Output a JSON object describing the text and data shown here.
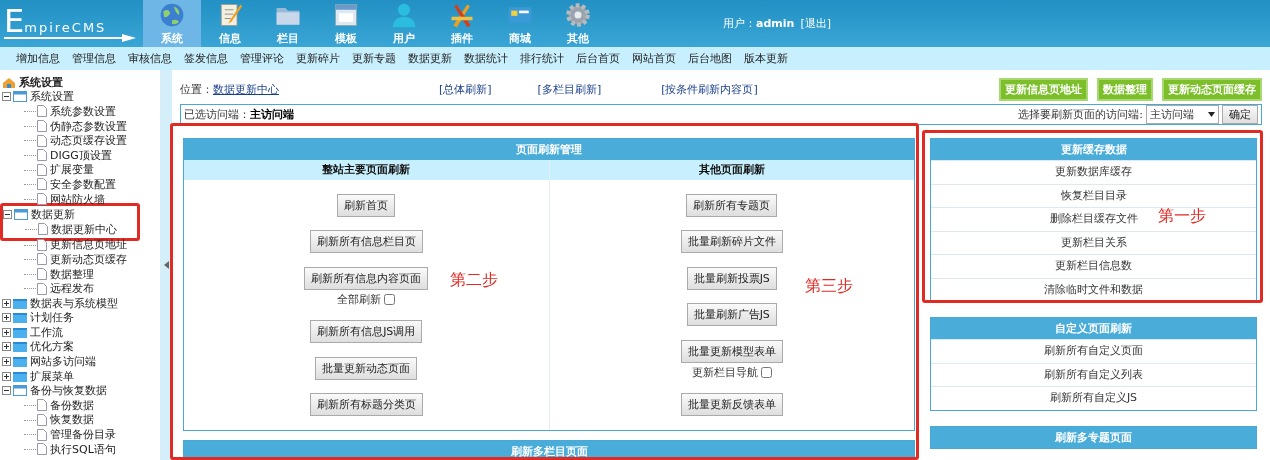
{
  "header": {
    "logo": "EmpireCMS",
    "nav": [
      {
        "label": "系统",
        "selected": true
      },
      {
        "label": "信息",
        "selected": false
      },
      {
        "label": "栏目",
        "selected": false
      },
      {
        "label": "模板",
        "selected": false
      },
      {
        "label": "用户",
        "selected": false
      },
      {
        "label": "插件",
        "selected": false
      },
      {
        "label": "商城",
        "selected": false
      },
      {
        "label": "其他",
        "selected": false
      }
    ],
    "user": {
      "label": "用户：",
      "name": "admin",
      "logout": "[退出]"
    }
  },
  "menu": [
    "增加信息",
    "管理信息",
    "审核信息",
    "签发信息",
    "管理评论",
    "更新碎片",
    "更新专题",
    "数据更新",
    "数据统计",
    "排行统计",
    "后台首页",
    "网站首页",
    "后台地图",
    "版本更新"
  ],
  "sidebar": {
    "title": "系统设置",
    "items": [
      {
        "label": "系统设置",
        "expanded": true,
        "children": [
          {
            "label": "系统参数设置"
          },
          {
            "label": "伪静态参数设置"
          },
          {
            "label": "动态页缓存设置"
          },
          {
            "label": "DIGG顶设置"
          },
          {
            "label": "扩展变量"
          },
          {
            "label": "安全参数配置"
          },
          {
            "label": "网站防火墙"
          }
        ]
      },
      {
        "label": "数据更新",
        "expanded": true,
        "children": [
          {
            "label": "数据更新中心"
          },
          {
            "label": "更新信息页地址"
          },
          {
            "label": "更新动态页缓存"
          },
          {
            "label": "数据整理"
          },
          {
            "label": "远程发布"
          }
        ]
      },
      {
        "label": "数据表与系统模型",
        "expanded": false
      },
      {
        "label": "计划任务",
        "expanded": false
      },
      {
        "label": "工作流",
        "expanded": false
      },
      {
        "label": "优化方案",
        "expanded": false
      },
      {
        "label": "网站多访问端",
        "expanded": false
      },
      {
        "label": "扩展菜单",
        "expanded": false
      },
      {
        "label": "备份与恢复数据",
        "expanded": true,
        "children": [
          {
            "label": "备份数据"
          },
          {
            "label": "恢复数据"
          },
          {
            "label": "管理备份目录"
          },
          {
            "label": "执行SQL语句"
          }
        ]
      }
    ]
  },
  "location": {
    "label": "位置：",
    "current": "数据更新中心",
    "links": [
      "[总体刷新]",
      "[多栏目刷新]",
      "[按条件刷新内容页]"
    ],
    "buttons": [
      "更新信息页地址",
      "数据整理",
      "更新动态页面缓存"
    ]
  },
  "access": {
    "label": "已选访问端：",
    "current": "主访问端",
    "select_label": "选择要刷新页面的访问端:",
    "select_value": "主访问端",
    "confirm": "确定"
  },
  "refresh_panel": {
    "title": "页面刷新管理",
    "columns": [
      {
        "title": "整站主要页面刷新",
        "items": [
          {
            "label": "刷新首页"
          },
          {
            "label": "刷新所有信息栏目页"
          },
          {
            "label": "刷新所有信息内容页面",
            "option": {
              "label": "全部刷新",
              "checked": false
            }
          },
          {
            "label": "刷新所有信息JS调用"
          },
          {
            "label": "批量更新动态页面"
          },
          {
            "label": "刷新所有标题分类页"
          }
        ]
      },
      {
        "title": "其他页面刷新",
        "items": [
          {
            "label": "刷新所有专题页"
          },
          {
            "label": "批量刷新碎片文件"
          },
          {
            "label": "批量刷新投票JS"
          },
          {
            "label": "批量刷新广告JS"
          },
          {
            "label": "批量更新模型表单",
            "option": {
              "label": "更新栏目导航",
              "checked": false
            }
          },
          {
            "label": "批量更新反馈表单"
          }
        ]
      }
    ]
  },
  "multi_panel": {
    "title": "刷新多栏目页面"
  },
  "side_panels": [
    {
      "title": "更新缓存数据",
      "links": [
        "更新数据库缓存",
        "恢复栏目目录",
        "删除栏目缓存文件",
        "更新栏目关系",
        "更新栏目信息数",
        "清除临时文件和数据"
      ]
    },
    {
      "title": "自定义页面刷新",
      "links": [
        "刷新所有自定义页面",
        "刷新所有自定义列表",
        "刷新所有自定义JS"
      ]
    },
    {
      "title": "刷新多专题页面"
    }
  ],
  "step_labels": [
    "第一步",
    "第二步",
    "第三步"
  ]
}
